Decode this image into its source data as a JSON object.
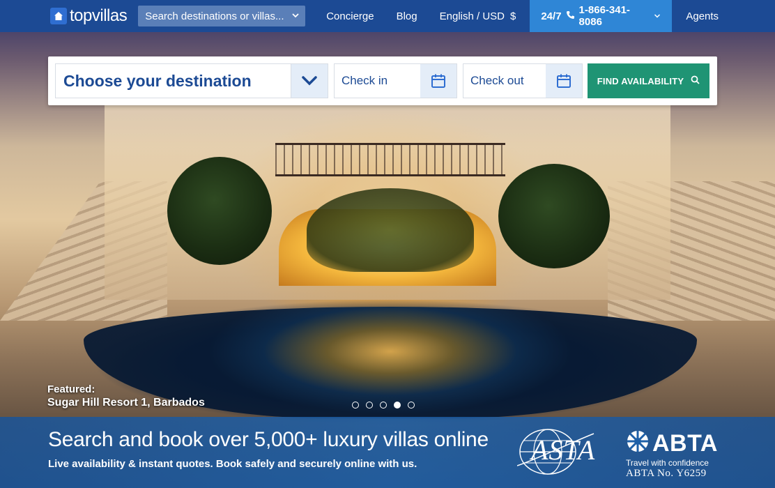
{
  "nav": {
    "logo_text": "topvillas",
    "search_placeholder": "Search destinations or villas...",
    "concierge": "Concierge",
    "blog": "Blog",
    "language_currency": "English / USD",
    "currency_symbol": "$",
    "phone_prefix": "24/7",
    "phone_number": "1-866-341-8086",
    "agents": "Agents"
  },
  "search": {
    "destination_label": "Choose your destination",
    "checkin_label": "Check in",
    "checkout_label": "Check out",
    "find_button": "FIND AVAILABILITY"
  },
  "featured": {
    "label": "Featured:",
    "name": "Sugar Hill Resort 1, Barbados"
  },
  "carousel": {
    "count": 5,
    "active_index": 3
  },
  "banner": {
    "title": "Search and book over 5,000+ luxury villas online",
    "subtitle": "Live availability & instant quotes. Book safely and securely online with us.",
    "asta_text": "ASTA",
    "abta_text": "ABTA",
    "abta_tagline": "Travel with confidence",
    "abta_number": "ABTA No. Y6259"
  },
  "colors": {
    "nav_bg": "#1c4a94",
    "phone_bg": "#2f86d6",
    "find_button_bg": "#1f9474",
    "brand_blue": "#1c4a94"
  },
  "icons": [
    "home-icon",
    "chevron-down-icon",
    "phone-icon",
    "calendar-icon",
    "search-icon",
    "globe-icon",
    "abta-mark-icon"
  ]
}
